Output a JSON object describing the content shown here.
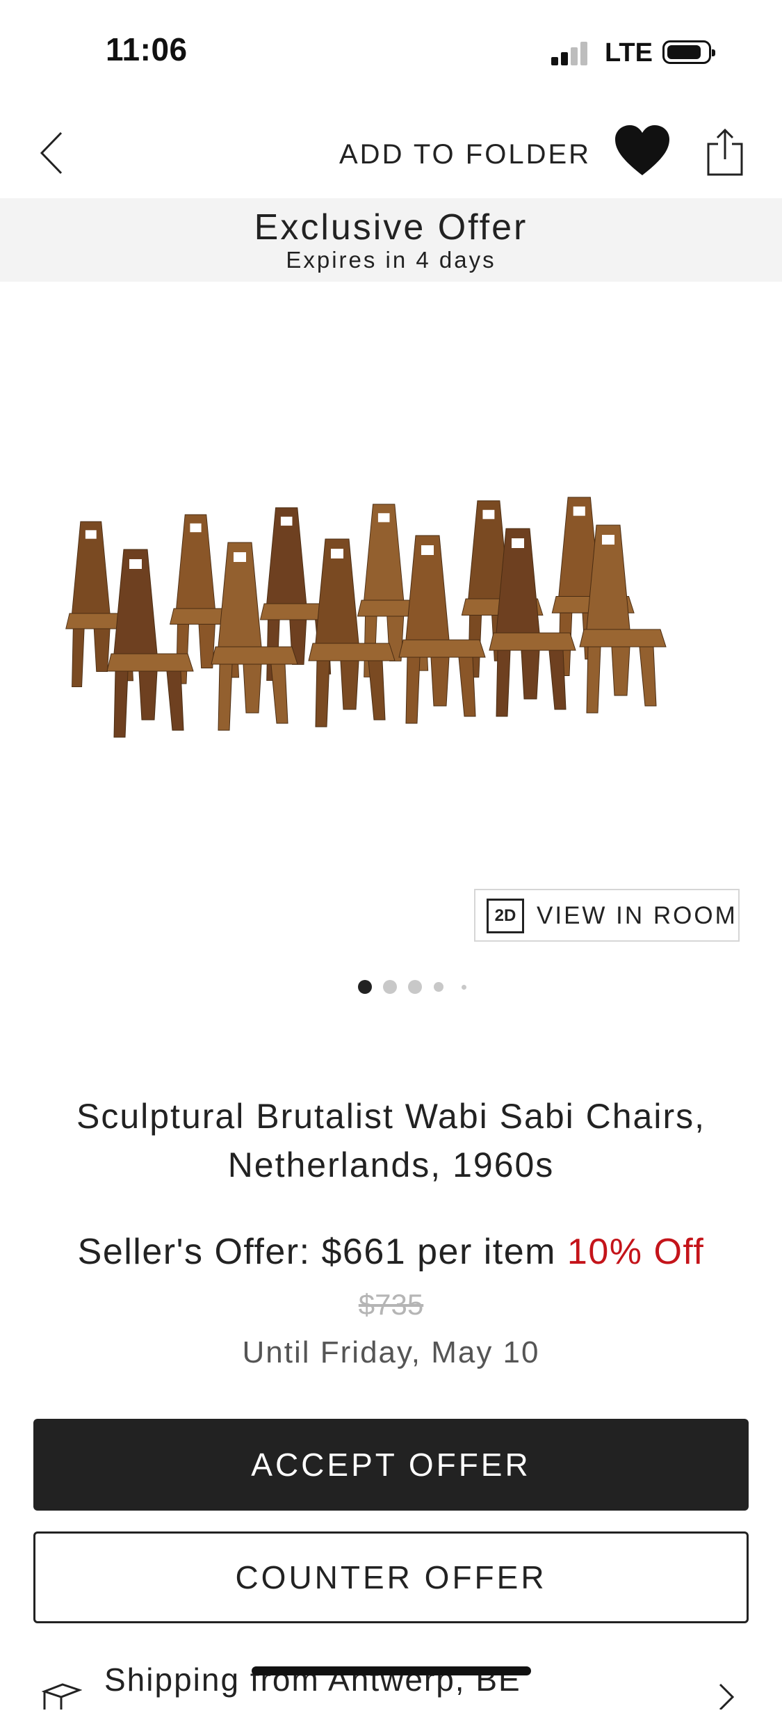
{
  "status_bar": {
    "time": "11:06",
    "network": "LTE"
  },
  "header": {
    "add_to_folder": "ADD TO FOLDER"
  },
  "banner": {
    "title": "Exclusive Offer",
    "subtitle": "Expires in 4 days"
  },
  "gallery": {
    "view_in_room_badge": "2D",
    "view_in_room_label": "VIEW IN ROOM",
    "page_count": 5,
    "current_page": 1
  },
  "product": {
    "title": "Sculptural Brutalist Wabi Sabi Chairs, Netherlands, 1960s",
    "offer_prefix": "Seller's Offer: $661 per item",
    "discount": "10% Off",
    "original_price": "$735",
    "until": "Until Friday, May 10"
  },
  "actions": {
    "accept": "ACCEPT OFFER",
    "counter": "COUNTER OFFER"
  },
  "shipping": {
    "text": "Shipping from Antwerp, BE"
  },
  "colors": {
    "accent_red": "#c4141a",
    "button_dark": "#222222",
    "banner_bg": "#f3f3f3"
  }
}
